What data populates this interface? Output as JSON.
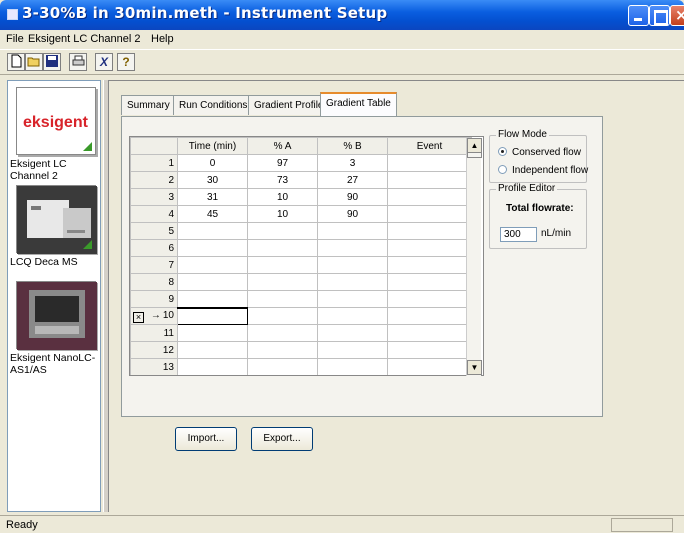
{
  "window": {
    "title": "3-30%B in 30min.meth - Instrument Setup"
  },
  "menu": [
    "File",
    "Eksigent LC Channel 2",
    "Help"
  ],
  "toolbar": {
    "new": "new-doc-icon",
    "open": "open-folder-icon",
    "save": "save-icon",
    "print": "print-icon",
    "cut_glyph": "X",
    "help_glyph": "?"
  },
  "channels": [
    {
      "label": "Eksigent LC Channel 2",
      "logo": "eksigent"
    },
    {
      "label": "LCQ Deca MS"
    },
    {
      "label": "Eksigent NanoLC-AS1/AS"
    }
  ],
  "tabs": [
    "Summary",
    "Run Conditions",
    "Gradient Profile",
    "Gradient Table"
  ],
  "active_tab": "Gradient Table",
  "grid": {
    "columns": [
      "Time (min)",
      "% A",
      "% B",
      "Event"
    ],
    "rows": [
      {
        "n": "1",
        "time": "0",
        "a": "97",
        "b": "3",
        "event": ""
      },
      {
        "n": "2",
        "time": "30",
        "a": "73",
        "b": "27",
        "event": ""
      },
      {
        "n": "3",
        "time": "31",
        "a": "10",
        "b": "90",
        "event": ""
      },
      {
        "n": "4",
        "time": "45",
        "a": "10",
        "b": "90",
        "event": ""
      },
      {
        "n": "5",
        "time": "",
        "a": "",
        "b": "",
        "event": ""
      },
      {
        "n": "6",
        "time": "",
        "a": "",
        "b": "",
        "event": ""
      },
      {
        "n": "7",
        "time": "",
        "a": "",
        "b": "",
        "event": ""
      },
      {
        "n": "8",
        "time": "",
        "a": "",
        "b": "",
        "event": ""
      },
      {
        "n": "9",
        "time": "",
        "a": "",
        "b": "",
        "event": ""
      },
      {
        "n": "10",
        "time": "",
        "a": "",
        "b": "",
        "event": ""
      },
      {
        "n": "11",
        "time": "",
        "a": "",
        "b": "",
        "event": ""
      },
      {
        "n": "12",
        "time": "",
        "a": "",
        "b": "",
        "event": ""
      },
      {
        "n": "13",
        "time": "",
        "a": "",
        "b": "",
        "event": ""
      }
    ],
    "current_row_marker": "→"
  },
  "flow_mode": {
    "title": "Flow Mode",
    "options": [
      "Conserved flow",
      "Independent flow"
    ],
    "selected": "Conserved flow"
  },
  "profile_editor": {
    "title": "Profile Editor",
    "total_flowrate_label": "Total flowrate:",
    "value": "300",
    "unit": "nL/min"
  },
  "buttons": {
    "import": "Import...",
    "export": "Export..."
  },
  "status": {
    "text": "Ready"
  },
  "colors": {
    "title_bar": "#0a5ee0",
    "active_tab_accent": "#e68b2c",
    "logo_red": "#d8232a"
  }
}
